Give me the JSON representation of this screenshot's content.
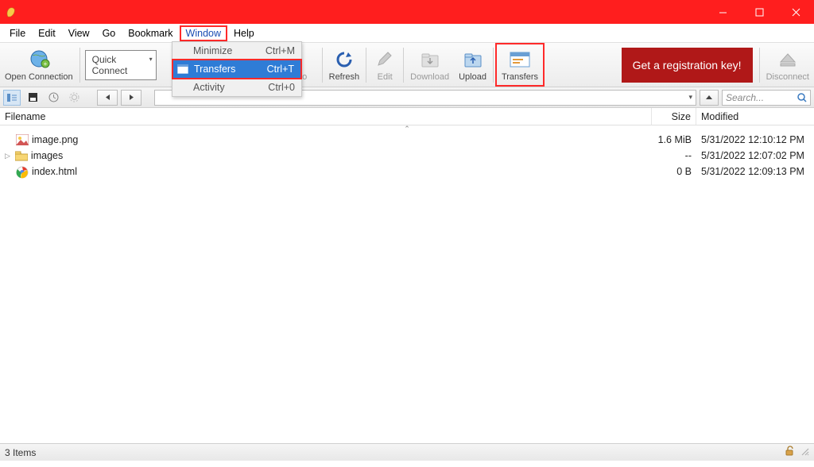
{
  "menubar": [
    "File",
    "Edit",
    "View",
    "Go",
    "Bookmark",
    "Window",
    "Help"
  ],
  "menubar_active_index": 5,
  "dropdown": {
    "items": [
      {
        "label": "Minimize",
        "shortcut": "Ctrl+M"
      },
      {
        "label": "Transfers",
        "shortcut": "Ctrl+T"
      },
      {
        "label": "Activity",
        "shortcut": "Ctrl+0"
      }
    ],
    "selected_index": 1
  },
  "toolbar": {
    "open_connection": "Open Connection",
    "quick_connect": "Quick Connect",
    "info": "fo",
    "refresh": "Refresh",
    "edit": "Edit",
    "download": "Download",
    "upload": "Upload",
    "transfers": "Transfers",
    "reg_key": "Get a registration key!",
    "disconnect": "Disconnect"
  },
  "navbar": {
    "path_display": "",
    "search_placeholder": "Search..."
  },
  "columns": {
    "filename": "Filename",
    "size": "Size",
    "modified": "Modified"
  },
  "files": [
    {
      "name": "image.png",
      "size": "1.6 MiB",
      "modified": "5/31/2022 12:10:12 PM",
      "icon": "image"
    },
    {
      "name": "images",
      "size": "--",
      "modified": "5/31/2022 12:07:02 PM",
      "icon": "folder",
      "expandable": true
    },
    {
      "name": "index.html",
      "size": "0 B",
      "modified": "5/31/2022 12:09:13 PM",
      "icon": "chrome"
    }
  ],
  "status": {
    "items": "3 Items"
  }
}
